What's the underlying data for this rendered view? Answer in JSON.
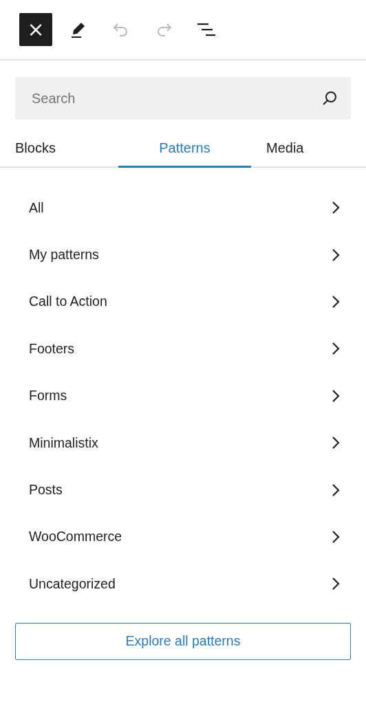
{
  "toolbar": {
    "close": {
      "label": "×"
    },
    "undo_disabled": true,
    "redo_disabled": true
  },
  "search": {
    "placeholder": "Search"
  },
  "tabs": [
    {
      "label": "Blocks",
      "selected": false
    },
    {
      "label": "Patterns",
      "selected": true
    },
    {
      "label": "Media",
      "selected": false
    }
  ],
  "categories": [
    {
      "label": "All"
    },
    {
      "label": "My patterns"
    },
    {
      "label": "Call to Action"
    },
    {
      "label": "Footers"
    },
    {
      "label": "Forms"
    },
    {
      "label": "Minimalistix"
    },
    {
      "label": "Posts"
    },
    {
      "label": "WooCommerce"
    },
    {
      "label": "Uncategorized"
    }
  ],
  "explore_button": {
    "label": "Explore all patterns"
  }
}
